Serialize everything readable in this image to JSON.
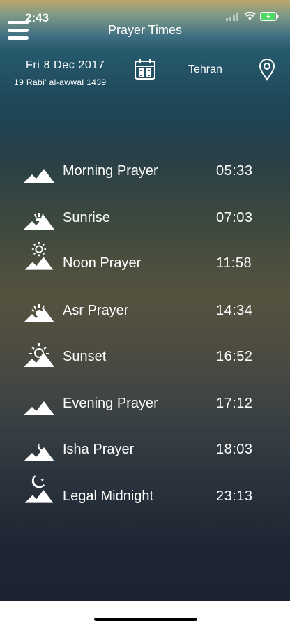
{
  "status": {
    "time": "2:43"
  },
  "header": {
    "title": "Prayer Times"
  },
  "date": {
    "gregorian": "Fri  8  Dec  2017",
    "hijri": "19  Rabi' al-awwal  1439"
  },
  "location": {
    "city": "Tehran"
  },
  "icons": {
    "menu": "hamburger-icon",
    "calendar": "calendar-icon",
    "location": "location-pin-icon",
    "battery": "battery-charging-icon",
    "wifi": "wifi-icon",
    "signal": "cellular-signal-icon"
  },
  "colors": {
    "battery_fill": "#4cd964"
  },
  "prayers": [
    {
      "name": "Morning Prayer",
      "time": "05:33",
      "icon": "mountain-icon"
    },
    {
      "name": "Sunrise",
      "time": "07:03",
      "icon": "mountain-sunrise-icon"
    },
    {
      "name": "Noon Prayer",
      "time": "11:58",
      "icon": "mountain-sun-icon"
    },
    {
      "name": "Asr Prayer",
      "time": "14:34",
      "icon": "mountain-sun-low-icon"
    },
    {
      "name": "Sunset",
      "time": "16:52",
      "icon": "mountain-sunset-icon"
    },
    {
      "name": "Evening Prayer",
      "time": "17:12",
      "icon": "mountain-crescent-icon"
    },
    {
      "name": "Isha Prayer",
      "time": "18:03",
      "icon": "mountain-crescent-small-icon"
    },
    {
      "name": "Legal Midnight",
      "time": "23:13",
      "icon": "mountain-moon-star-icon"
    }
  ]
}
